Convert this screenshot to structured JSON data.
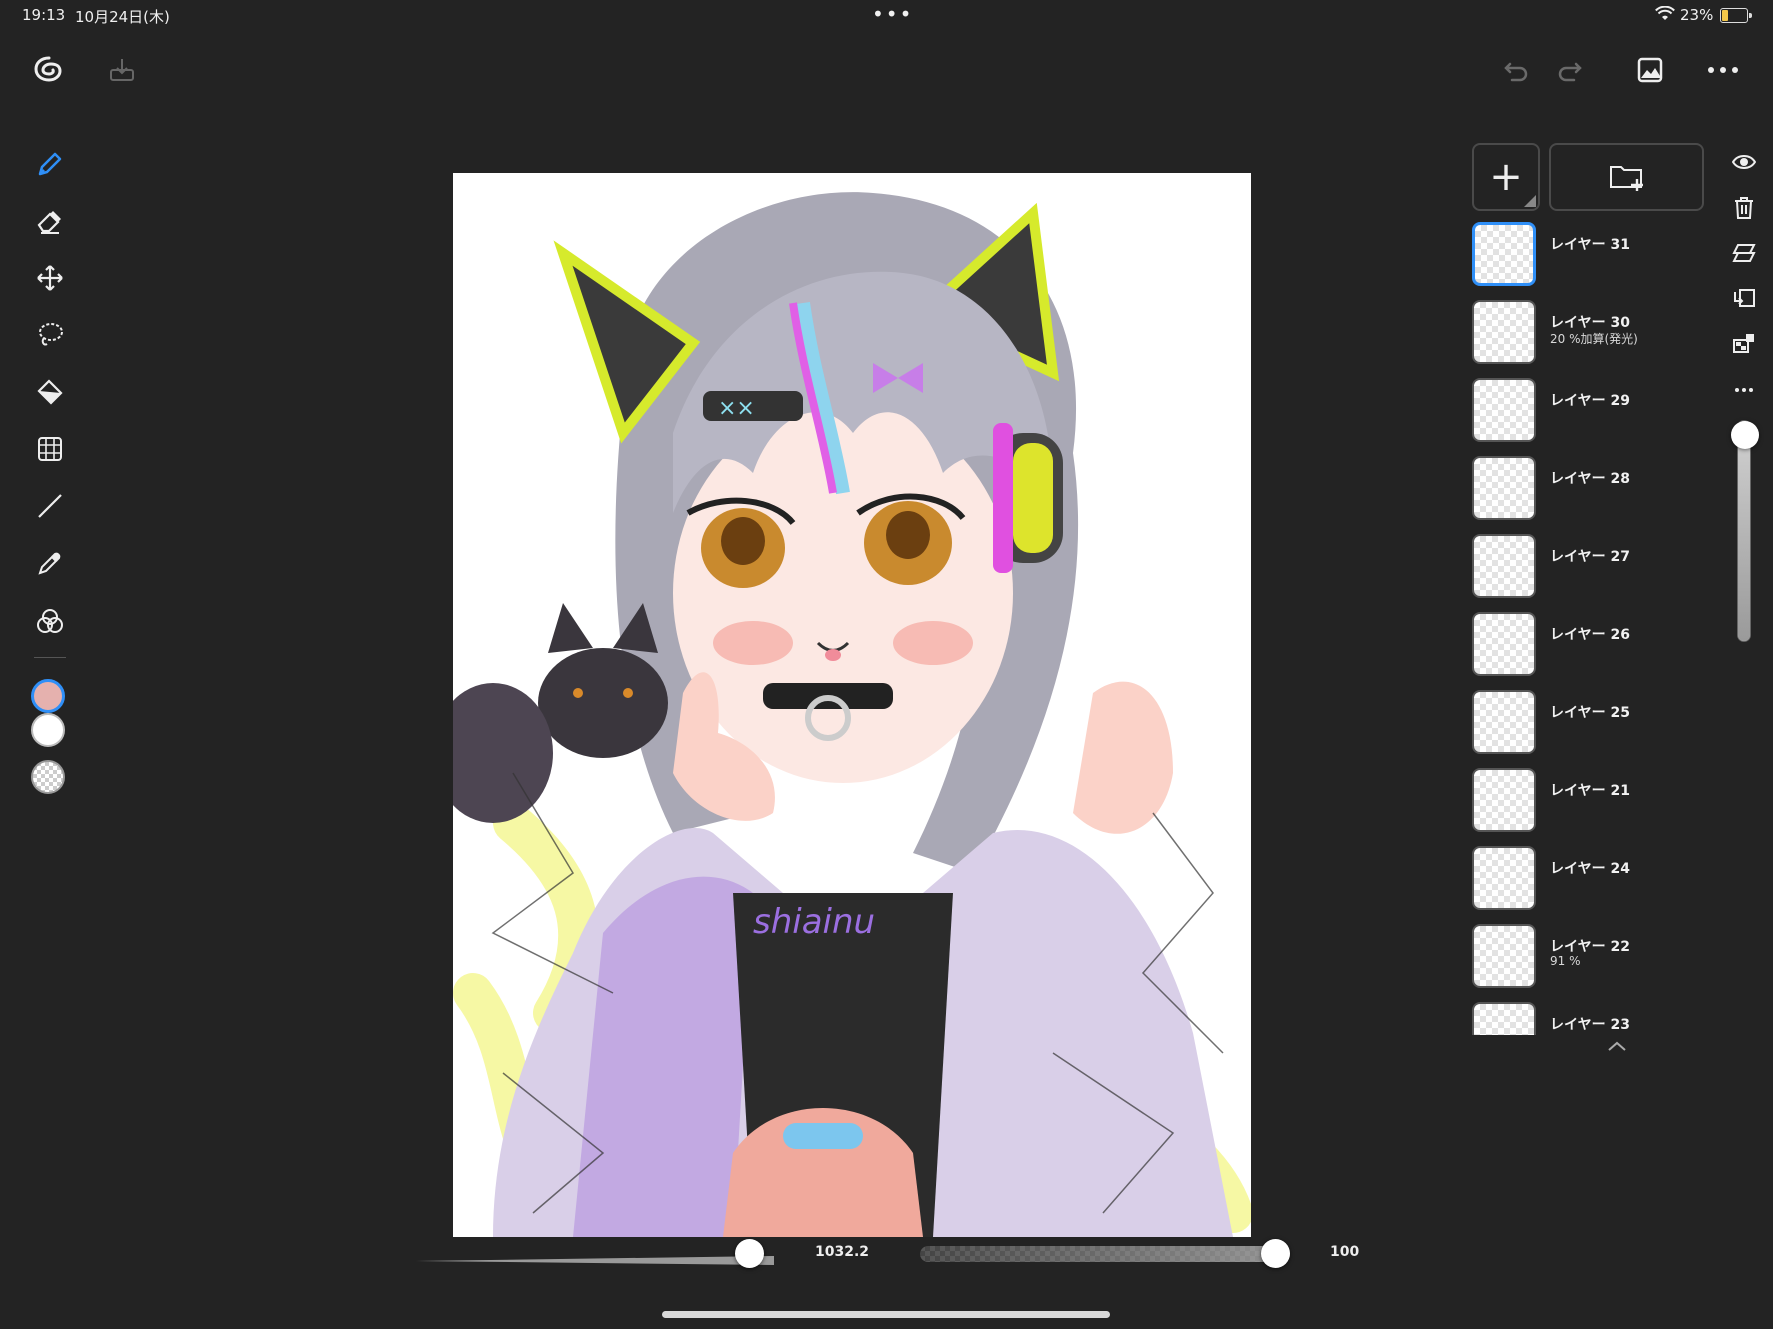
{
  "status_bar": {
    "time": "19:13",
    "date": "10月24日(木)",
    "battery": "23%",
    "multitask_dots": "•••"
  },
  "toolbar": {
    "left_icons": [
      "app-logo-icon",
      "import-icon"
    ],
    "right_icons": [
      "undo-icon",
      "redo-icon",
      "reference-image-icon",
      "more-menu-icon"
    ]
  },
  "tools": [
    {
      "name": "pen-tool",
      "active": true
    },
    {
      "name": "eraser-tool"
    },
    {
      "name": "move-tool"
    },
    {
      "name": "lasso-tool"
    },
    {
      "name": "fill-tool"
    },
    {
      "name": "transform-tool"
    },
    {
      "name": "line-tool"
    },
    {
      "name": "eyedropper-tool"
    },
    {
      "name": "color-blend-tool"
    }
  ],
  "colors": {
    "primary": "#e5b1ae",
    "secondary": "#ffffff",
    "accent": "#2f8ff7"
  },
  "layers_panel": {
    "add_button_label": "+",
    "layers": [
      {
        "name": "レイヤー 31",
        "sub": "",
        "selected": true
      },
      {
        "name": "レイヤー 30",
        "sub": "20 %加算(発光)"
      },
      {
        "name": "レイヤー 29",
        "sub": ""
      },
      {
        "name": "レイヤー 28",
        "sub": ""
      },
      {
        "name": "レイヤー 27",
        "sub": ""
      },
      {
        "name": "レイヤー 26",
        "sub": ""
      },
      {
        "name": "レイヤー 25",
        "sub": ""
      },
      {
        "name": "レイヤー 21",
        "sub": ""
      },
      {
        "name": "レイヤー 24",
        "sub": ""
      },
      {
        "name": "レイヤー 22",
        "sub": "91 %"
      },
      {
        "name": "レイヤー 23",
        "sub": ""
      }
    ]
  },
  "layer_actions": [
    "visibility-icon",
    "trash-icon",
    "merge-icon",
    "clipping-icon",
    "alpha-lock-icon",
    "more-dots-icon"
  ],
  "layer_opacity_level": 0.95,
  "brush": {
    "size_value": "1032.2",
    "size_level": 0.93,
    "opacity_value": "100",
    "opacity_level": 1.0
  }
}
